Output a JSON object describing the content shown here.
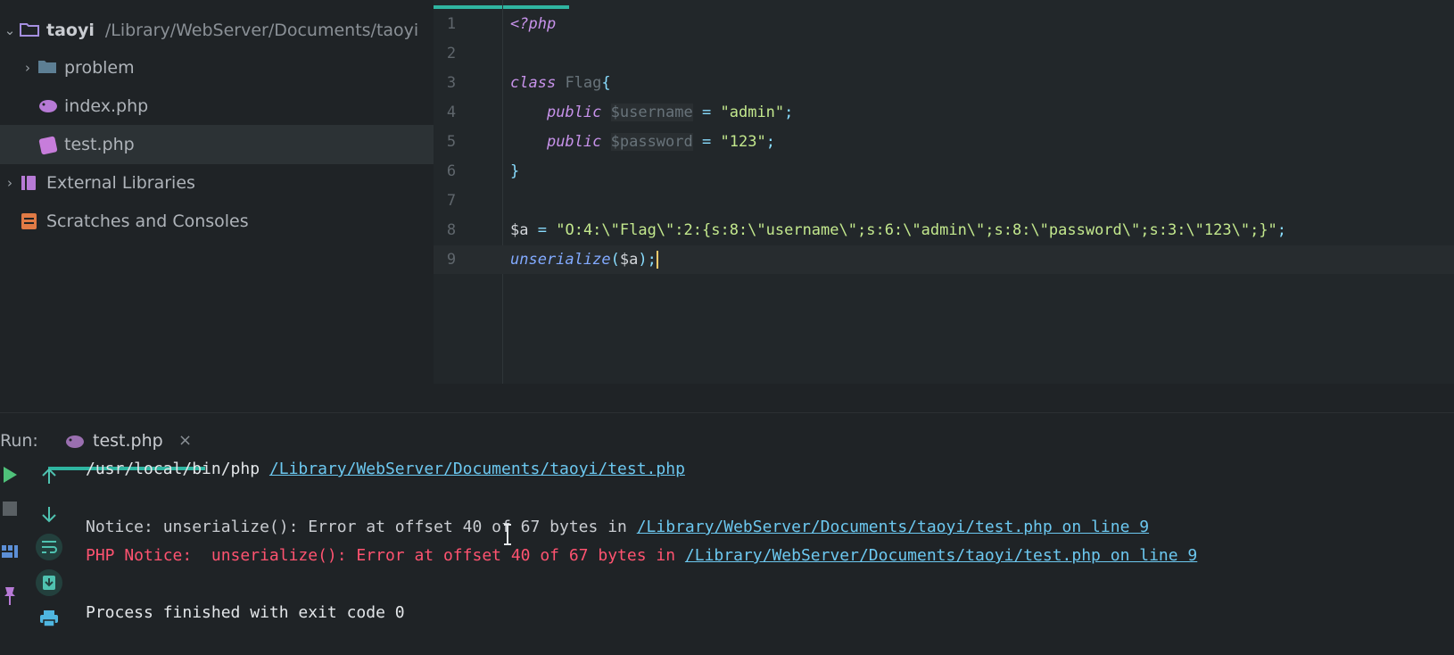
{
  "project_tree": {
    "root": {
      "name": "taoyi",
      "path": "/Library/WebServer/Documents/taoyi"
    },
    "items": [
      {
        "label": "problem",
        "kind": "folder"
      },
      {
        "label": "index.php",
        "kind": "php-file"
      },
      {
        "label": "test.php",
        "kind": "php-file",
        "selected": true
      }
    ],
    "external_libraries": "External Libraries",
    "scratches": "Scratches and Consoles"
  },
  "editor": {
    "lines": [
      {
        "n": "1",
        "open_tag": "<?php"
      },
      {
        "n": "2"
      },
      {
        "n": "3",
        "kw": "class",
        "name": "Flag",
        "brace": "{"
      },
      {
        "n": "4",
        "kw": "public",
        "var": "$username",
        "eq": "=",
        "val": "\"admin\"",
        "semi": ";"
      },
      {
        "n": "5",
        "kw": "public",
        "var": "$password",
        "eq": "=",
        "val": "\"123\"",
        "semi": ";"
      },
      {
        "n": "6",
        "brace": "}"
      },
      {
        "n": "7"
      },
      {
        "n": "8",
        "var": "$a",
        "eq": "=",
        "val": "\"O:4:\\\"Flag\\\":2:{s:8:\\\"username\\\";s:6:\\\"admin\\\";s:8:\\\"password\\\";s:3:\\\"123\\\";}\"",
        "semi": ";"
      },
      {
        "n": "9",
        "fn": "unserialize",
        "open": "(",
        "arg": "$a",
        "close": ")",
        "semi": ";"
      }
    ]
  },
  "run_panel": {
    "label": "Run:",
    "tab_label": "test.php",
    "tab_close": "×",
    "output": {
      "cmd": "/usr/local/bin/php",
      "script_path": "/Library/WebServer/Documents/taoyi/test.php",
      "notice_text": "Notice: unserialize(): Error at offset 40 of 67 bytes in",
      "notice_link": "/Library/WebServer/Documents/taoyi/test.php on line 9",
      "php_notice_text": "PHP Notice:  unserialize(): Error at offset 40 of 67 bytes in",
      "php_notice_link": "/Library/WebServer/Documents/taoyi/test.php on line 9",
      "exit_text": "Process finished with exit code 0"
    },
    "toolbar": {
      "left": [
        "run-icon",
        "stop-icon",
        "layout-icon",
        "pin-icon"
      ],
      "right": [
        "arrow-up-icon",
        "arrow-down-icon",
        "soft-wrap-icon",
        "scroll-to-end-icon",
        "print-icon"
      ]
    }
  },
  "colors": {
    "accent": "#2fb5a1",
    "error": "#ff5370",
    "link": "#6cc8f0",
    "keyword": "#c792ea",
    "string": "#c3e88d"
  }
}
